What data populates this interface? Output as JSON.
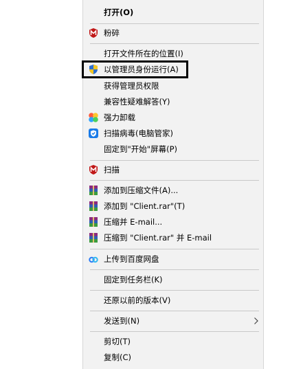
{
  "menu": {
    "open": "打开(O)",
    "shred": "粉碎",
    "open_location": "打开文件所在的位置(I)",
    "run_as_admin": "以管理员身份运行(A)",
    "take_ownership": "获得管理员权限",
    "compat_troubleshoot": "兼容性疑难解答(Y)",
    "force_uninstall": "强力卸载",
    "scan_virus": "扫描病毒(电脑管家)",
    "pin_start": "固定到\"开始\"屏幕(P)",
    "scan": "扫描",
    "add_archive": "添加到压缩文件(A)...",
    "add_client_rar": "添加到 \"Client.rar\"(T)",
    "compress_email": "压缩并 E-mail...",
    "compress_client_email": "压缩到 \"Client.rar\" 并 E-mail",
    "upload_baidu": "上传到百度网盘",
    "pin_taskbar": "固定到任务栏(K)",
    "restore_prev": "还原以前的版本(V)",
    "send_to": "发送到(N)",
    "cut": "剪切(T)",
    "copy": "复制(C)"
  },
  "icons": {
    "shred": "mcafee-icon",
    "run_as_admin": "uac-shield-icon",
    "force_uninstall": "colorful-uninstall-icon",
    "scan_virus": "tencent-shield-icon",
    "scan": "mcafee-icon",
    "archive": "winrar-icon",
    "baidu": "baidu-netdisk-icon",
    "submenu": "chevron-right-icon"
  },
  "colors": {
    "menu_background": "#f2f2f2",
    "separator": "#c8c8c8",
    "mcafee_red": "#c01818",
    "highlight_border": "#000000"
  }
}
